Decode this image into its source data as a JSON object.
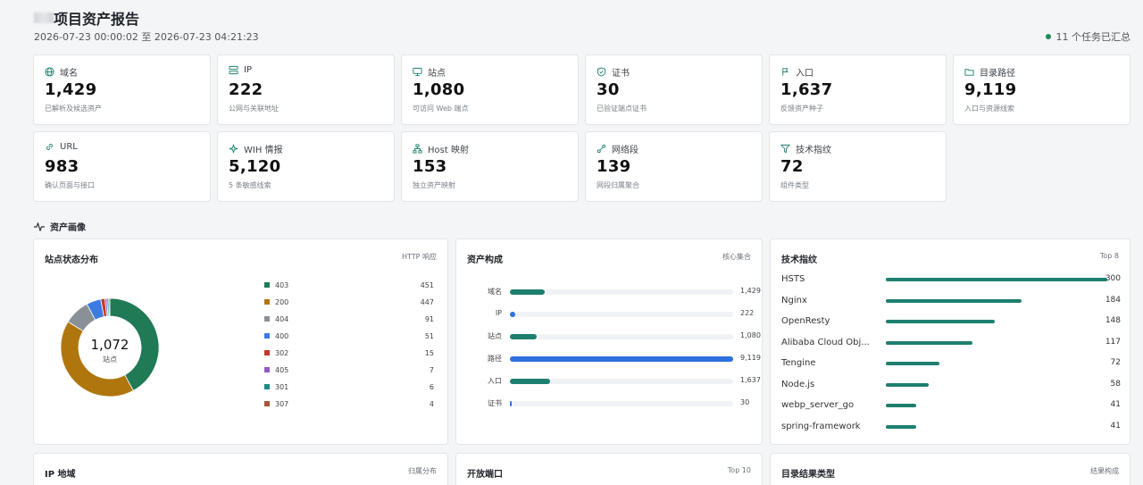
{
  "header": {
    "title": "项目资产报告",
    "range": "2026-07-23 00:00:02 至 2026-07-23 04:21:23",
    "status": "11 个任务已汇总"
  },
  "stats": [
    {
      "icon": "globe-icon",
      "label": "域名",
      "value": "1,429",
      "sub": "已解析及候选资产"
    },
    {
      "icon": "server-icon",
      "label": "IP",
      "value": "222",
      "sub": "公网与关联地址"
    },
    {
      "icon": "monitor-icon",
      "label": "站点",
      "value": "1,080",
      "sub": "可访问 Web 端点"
    },
    {
      "icon": "shield-check-icon",
      "label": "证书",
      "value": "30",
      "sub": "已验证端点证书"
    },
    {
      "icon": "entry-icon",
      "label": "入口",
      "value": "1,637",
      "sub": "反馈资产种子"
    },
    {
      "icon": "folder-icon",
      "label": "目录路径",
      "value": "9,119",
      "sub": "入口与资源线索"
    },
    {
      "icon": "link-icon",
      "label": "URL",
      "value": "983",
      "sub": "确认页面与接口"
    },
    {
      "icon": "sparkle-icon",
      "label": "WIH 情报",
      "value": "5,120",
      "sub": "5 条敏感线索"
    },
    {
      "icon": "sitemap-icon",
      "label": "Host 映射",
      "value": "153",
      "sub": "独立资产映射"
    },
    {
      "icon": "network-icon",
      "label": "网络段",
      "value": "139",
      "sub": "网段归属聚合"
    },
    {
      "icon": "filter-icon",
      "label": "技术指纹",
      "value": "72",
      "sub": "组件类型"
    }
  ],
  "section": {
    "label": "资产画像"
  },
  "status_panel": {
    "title": "站点状态分布",
    "tag": "HTTP 响应",
    "total": "1,072",
    "total_label": "站点"
  },
  "composition_panel": {
    "title": "资产构成",
    "tag": "核心集合"
  },
  "tech_panel": {
    "title": "技术指纹",
    "tag": "Top 8"
  },
  "bottom_panels": [
    {
      "title": "IP 地域",
      "tag": "归属分布"
    },
    {
      "title": "开放端口",
      "tag": "Top 10"
    },
    {
      "title": "目录结果类型",
      "tag": "结果构成"
    }
  ],
  "chart_data": [
    {
      "type": "pie",
      "title": "站点状态分布",
      "categories": [
        "403",
        "200",
        "404",
        "400",
        "302",
        "405",
        "301",
        "307"
      ],
      "values": [
        451,
        447,
        91,
        51,
        15,
        7,
        6,
        4
      ],
      "colors": [
        "#1f7a55",
        "#b0760e",
        "#8a9097",
        "#3c7be0",
        "#c0392b",
        "#8e5bc7",
        "#1e8c86",
        "#a2583a"
      ]
    },
    {
      "type": "bar",
      "title": "资产构成",
      "categories": [
        "域名",
        "IP",
        "站点",
        "路径",
        "入口",
        "证书"
      ],
      "values": [
        1429,
        222,
        1080,
        9119,
        1637,
        30
      ],
      "value_labels": [
        "1,429",
        "222",
        "1,080",
        "9,119",
        "1,637",
        "30"
      ],
      "colors": [
        "#1e7f6e",
        "#2f6fdc",
        "#1e7f6e",
        "#2f6fdc",
        "#1e7f6e",
        "#2f6fdc"
      ]
    },
    {
      "type": "bar",
      "title": "技术指纹",
      "categories": [
        "HSTS",
        "Nginx",
        "OpenResty",
        "Alibaba Cloud Obj...",
        "Tengine",
        "Node.js",
        "webp_server_go",
        "spring-framework"
      ],
      "values": [
        300,
        184,
        148,
        117,
        72,
        58,
        41,
        41
      ]
    }
  ]
}
